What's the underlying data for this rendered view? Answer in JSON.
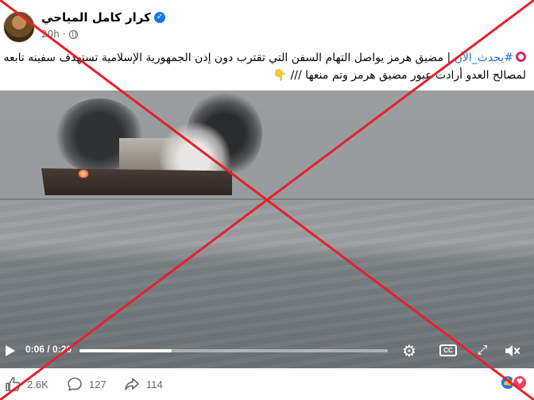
{
  "post": {
    "author": "كرار كامل المياحي",
    "time": "20h",
    "hashtag": "#يحدث_الآن",
    "text": " | مضيق هرمز يواصل التهام السفن التي تقترب دون إذن الجمهورية الإسلامية تستهدف سفينه تابعه لمصالح العدو أرادت عبور مضيق هرمز وتم منعها /// 👇"
  },
  "video": {
    "time": "0:06 / 0:20",
    "progress": 0.3
  },
  "footer": {
    "likes": "2.6K",
    "comments": "127",
    "shares": "114"
  },
  "icons": {
    "verified": "verified-badge-icon",
    "globe": "globe-icon",
    "play": "play-icon",
    "settings": "gear-icon",
    "captions": "cc-icon",
    "fullscreen": "expand-icon",
    "mute": "muted-speaker-icon",
    "like": "thumbs-up-icon",
    "comment": "comment-bubble-icon",
    "share": "share-arrow-icon"
  },
  "colors": {
    "link": "#216fdb",
    "like_blue": "#1877f2",
    "love_red": "#f33e58",
    "overlay_red": "#e8202a"
  }
}
